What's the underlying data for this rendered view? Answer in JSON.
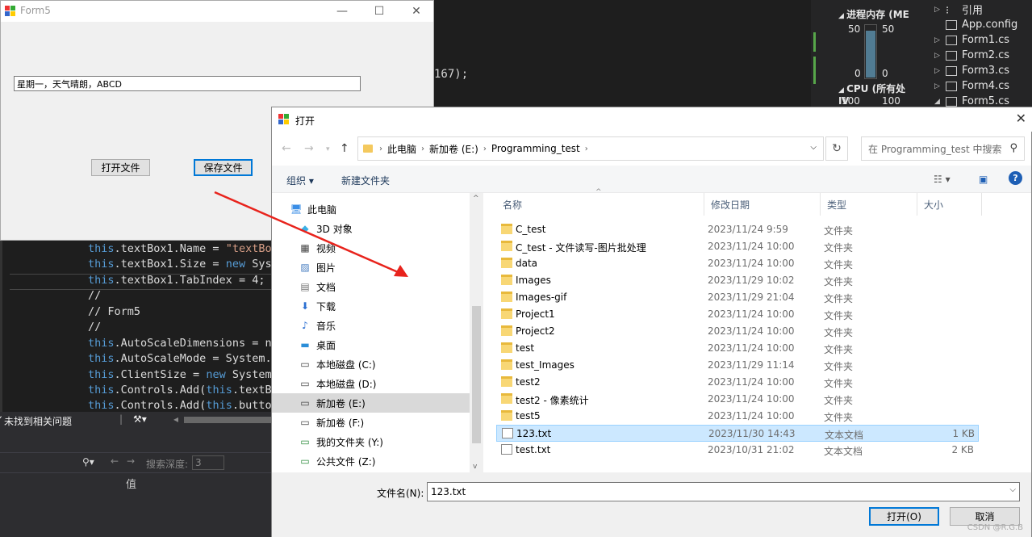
{
  "vs": {
    "code_fragment": "167);",
    "diag_title": "进程内存 (ME",
    "mem_top_left": "50",
    "mem_top_right": "50",
    "mem_bot_left": "0",
    "mem_bot_right": "0",
    "cpu_title": "CPU (所有处Ⅳ",
    "cpu_left": "100",
    "cpu_right": "100",
    "solution_items": [
      {
        "label": "引用",
        "expand": "▷"
      },
      {
        "label": "App.config",
        "expand": ""
      },
      {
        "label": "Form1.cs",
        "expand": "▷"
      },
      {
        "label": "Form2.cs",
        "expand": "▷"
      },
      {
        "label": "Form3.cs",
        "expand": "▷"
      },
      {
        "label": "Form4.cs",
        "expand": "▷"
      },
      {
        "label": "Form5.cs",
        "expand": "◢"
      }
    ],
    "status_text": "未找到相关问题",
    "search_depth_label": "搜索深度:",
    "search_depth_value": "3",
    "value_header": "值"
  },
  "form5": {
    "title": "Form5",
    "textbox_value": "星期一，天气晴朗，ABCD",
    "open_button": "打开文件",
    "save_button": "保存文件"
  },
  "dialog": {
    "title": "打开",
    "breadcrumb": [
      "此电脑",
      "新加卷 (E:)",
      "Programming_test"
    ],
    "search_placeholder": "在 Programming_test 中搜索",
    "organize": "组织 ▾",
    "new_folder": "新建文件夹",
    "nav_items": [
      {
        "label": "此电脑",
        "icon": "computer-icon"
      },
      {
        "label": "3D 对象",
        "icon": "3d-objects-icon"
      },
      {
        "label": "视频",
        "icon": "video-icon"
      },
      {
        "label": "图片",
        "icon": "pictures-icon"
      },
      {
        "label": "文档",
        "icon": "documents-icon"
      },
      {
        "label": "下载",
        "icon": "download-icon"
      },
      {
        "label": "音乐",
        "icon": "music-icon"
      },
      {
        "label": "桌面",
        "icon": "desktop-icon"
      },
      {
        "label": "本地磁盘 (C:)",
        "icon": "drive-c-icon"
      },
      {
        "label": "本地磁盘 (D:)",
        "icon": "drive-icon"
      },
      {
        "label": "新加卷 (E:)",
        "icon": "drive-icon",
        "selected": true
      },
      {
        "label": "新加卷 (F:)",
        "icon": "drive-icon"
      },
      {
        "label": "我的文件夹 (Y:)",
        "icon": "network-drive-icon"
      },
      {
        "label": "公共文件 (Z:)",
        "icon": "network-drive-icon"
      }
    ],
    "columns": [
      "名称",
      "修改日期",
      "类型",
      "大小"
    ],
    "files": [
      {
        "name": "C_test",
        "date": "2023/11/24 9:59",
        "type": "文件夹",
        "size": "",
        "kind": "folder"
      },
      {
        "name": "C_test - 文件读写-图片批处理",
        "date": "2023/11/24 10:00",
        "type": "文件夹",
        "size": "",
        "kind": "folder"
      },
      {
        "name": "data",
        "date": "2023/11/24 10:00",
        "type": "文件夹",
        "size": "",
        "kind": "folder"
      },
      {
        "name": "Images",
        "date": "2023/11/29 10:02",
        "type": "文件夹",
        "size": "",
        "kind": "folder"
      },
      {
        "name": "Images-gif",
        "date": "2023/11/29 21:04",
        "type": "文件夹",
        "size": "",
        "kind": "folder"
      },
      {
        "name": "Project1",
        "date": "2023/11/24 10:00",
        "type": "文件夹",
        "size": "",
        "kind": "folder"
      },
      {
        "name": "Project2",
        "date": "2023/11/24 10:00",
        "type": "文件夹",
        "size": "",
        "kind": "folder"
      },
      {
        "name": "test",
        "date": "2023/11/24 10:00",
        "type": "文件夹",
        "size": "",
        "kind": "folder"
      },
      {
        "name": "test_Images",
        "date": "2023/11/29 11:14",
        "type": "文件夹",
        "size": "",
        "kind": "folder"
      },
      {
        "name": "test2",
        "date": "2023/11/24 10:00",
        "type": "文件夹",
        "size": "",
        "kind": "folder"
      },
      {
        "name": "test2 - 像素统计",
        "date": "2023/11/24 10:00",
        "type": "文件夹",
        "size": "",
        "kind": "folder"
      },
      {
        "name": "test5",
        "date": "2023/11/24 10:00",
        "type": "文件夹",
        "size": "",
        "kind": "folder"
      },
      {
        "name": "123.txt",
        "date": "2023/11/30 14:43",
        "type": "文本文档",
        "size": "1 KB",
        "kind": "doc",
        "selected": true
      },
      {
        "name": "test.txt",
        "date": "2023/10/31 21:02",
        "type": "文本文档",
        "size": "2 KB",
        "kind": "doc"
      }
    ],
    "filename_label": "文件名(N):",
    "filename_value": "123.txt",
    "open_button": "打开(O)",
    "cancel_button": "取消",
    "watermark": "CSDN @R.G.B"
  }
}
